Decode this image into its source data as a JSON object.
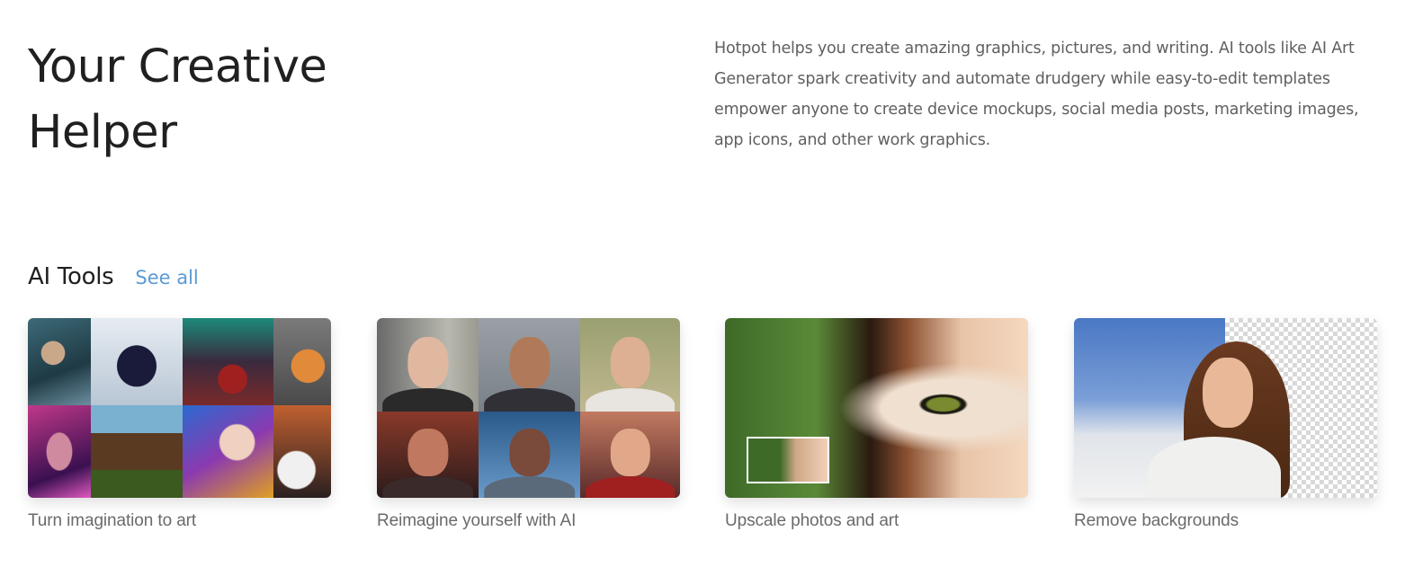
{
  "hero": {
    "title_line1": "Your Creative",
    "title_line2": "Helper",
    "description": "Hotpot helps you create amazing graphics, pictures, and writing. AI tools like AI Art Generator spark creativity and automate drudgery while easy-to-edit templates empower anyone to create device mockups, social media posts, marketing images, app icons, and other work graphics."
  },
  "ai_tools": {
    "title": "AI Tools",
    "see_all_label": "See all",
    "see_all_color": "#5a9bd5",
    "cards": [
      {
        "caption": "Turn imagination to art"
      },
      {
        "caption": "Reimagine yourself with AI"
      },
      {
        "caption": "Upscale photos and art"
      },
      {
        "caption": "Remove backgrounds"
      }
    ]
  }
}
